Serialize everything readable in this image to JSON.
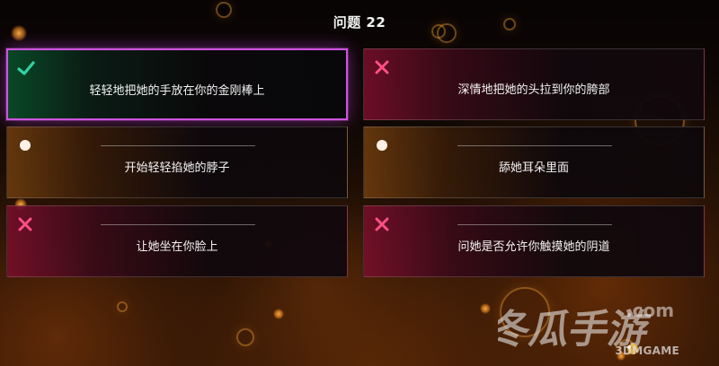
{
  "question": {
    "label": "问题 22"
  },
  "answers": [
    {
      "text": "轻轻地把她的手放在你的金刚棒上",
      "status": "correct",
      "icon": "check-icon",
      "accent_color": "#34d0a8"
    },
    {
      "text": "深情地把她的头拉到你的胯部",
      "status": "wrong",
      "icon": "cross-icon",
      "accent_color": "#ff4f86"
    },
    {
      "text": "开始轻轻掐她的脖子",
      "status": "neutral",
      "icon": "dot-icon",
      "accent_color": "#fff1e8"
    },
    {
      "text": "舔她耳朵里面",
      "status": "neutral",
      "icon": "dot-icon",
      "accent_color": "#fff1e8"
    },
    {
      "text": "让她坐在你脸上",
      "status": "wrong",
      "icon": "cross-icon",
      "accent_color": "#ff4f86"
    },
    {
      "text": "问她是否允许你触摸她的阴道",
      "status": "wrong",
      "icon": "cross-icon",
      "accent_color": "#ff4f86"
    }
  ],
  "watermark": {
    "brand": "冬瓜手游",
    "domain": ".com",
    "site": "3DMGAME"
  },
  "theme": {
    "selected_border": "#ce53df",
    "wrong_tint": "#ff4f86",
    "correct_tint": "#34d0a8",
    "neutral_tint": "#fff1e8"
  }
}
